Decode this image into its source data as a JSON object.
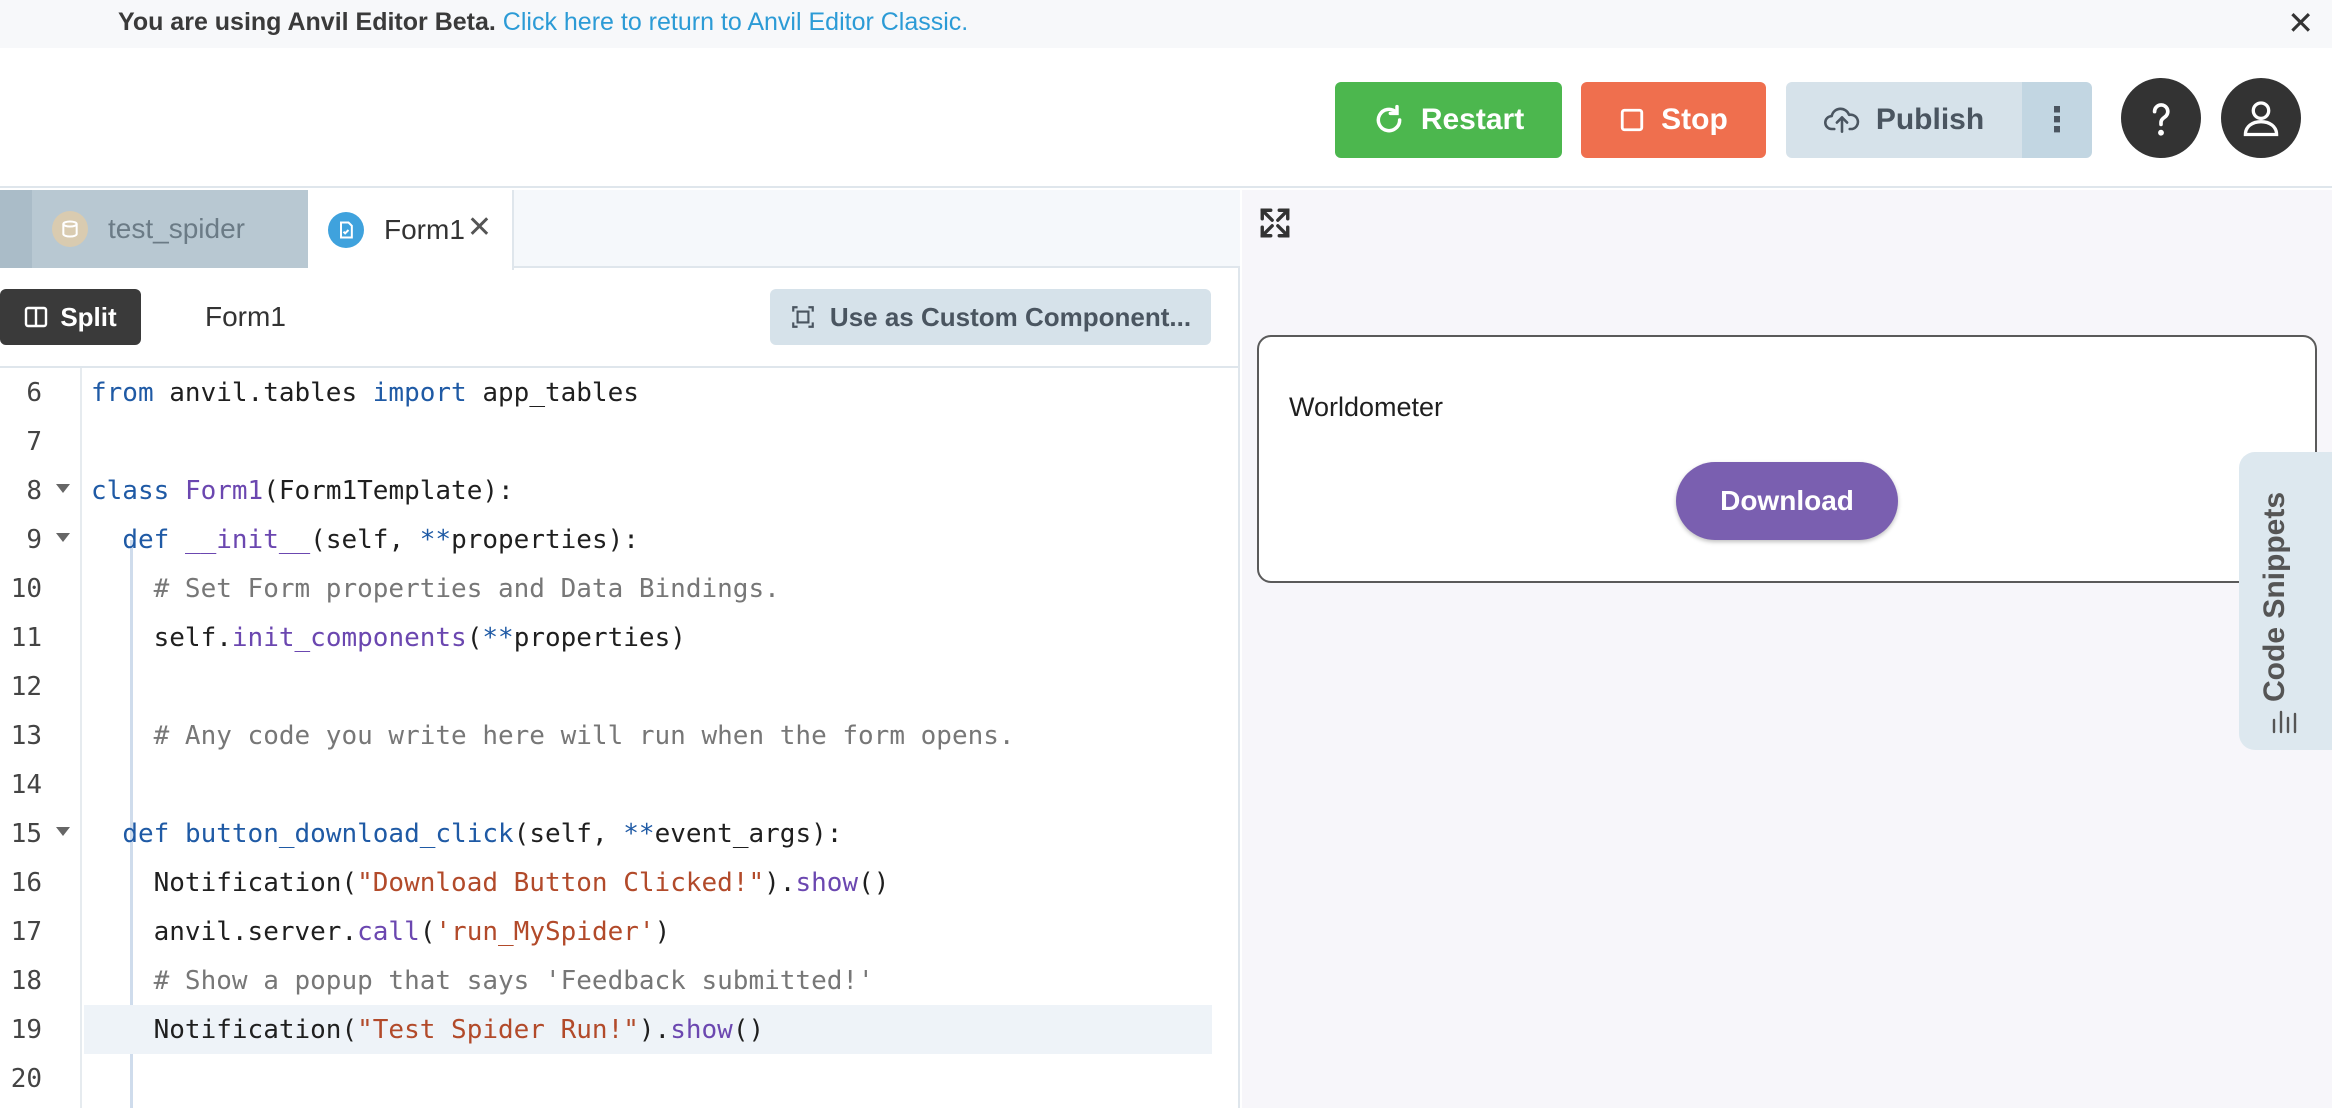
{
  "banner": {
    "bold_text": "You are using Anvil Editor Beta.",
    "link_text": "Click here to return to Anvil Editor Classic.",
    "close_glyph": "✕"
  },
  "toolbar": {
    "restart_label": "Restart",
    "stop_label": "Stop",
    "publish_label": "Publish",
    "more_glyph": "⋮",
    "colors": {
      "restart": "#4cb74e",
      "stop": "#ef6f4e",
      "publish": "#d6e2ea"
    }
  },
  "tabs": [
    {
      "label": "test_spider",
      "icon": "database-icon"
    },
    {
      "label": "Form1",
      "icon": "form-icon",
      "close": "✕"
    }
  ],
  "subbar": {
    "split_label": "Split",
    "form_title": "Form1",
    "custom_label": "Use as Custom Component..."
  },
  "code": {
    "lines": [
      {
        "n": "6"
      },
      {
        "n": "7"
      },
      {
        "n": "8"
      },
      {
        "n": "9"
      },
      {
        "n": "10"
      },
      {
        "n": "11"
      },
      {
        "n": "12"
      },
      {
        "n": "13"
      },
      {
        "n": "14"
      },
      {
        "n": "15"
      },
      {
        "n": "16"
      },
      {
        "n": "17"
      },
      {
        "n": "18"
      },
      {
        "n": "19"
      },
      {
        "n": "20"
      }
    ],
    "t": {
      "from": "from",
      "anvil_tables": " anvil.tables ",
      "import": "import",
      "app_tables": " app_tables",
      "class": "class",
      "form1": "Form1",
      "form1_tpl": "(Form1Template):",
      "def": "def",
      "init": "__init__",
      "init_args_a": "(self, ",
      "op": "**",
      "init_args_b": "properties):",
      "cm_set": "# Set Form properties and Data Bindings.",
      "self_dot": "self.",
      "init_components": "init_components",
      "init_comp_args_b": "properties)",
      "cm_any": "# Any code you write here will run when the form opens.",
      "btn_fn": "button_download_click",
      "btn_args_b": "event_args):",
      "notification": "Notification(",
      "str_dl": "\"Download Button Clicked!\"",
      "close_paren_dot": ").",
      "show": "show",
      "parens": "()",
      "anvil_server": "anvil.server.",
      "call": "call",
      "open_paren": "(",
      "str_spider": "'run_MySpider'",
      "close_paren": ")",
      "cm_popup": "# Show a popup that says 'Feedback submitted!'",
      "str_test": "\"Test Spider Run!\""
    }
  },
  "preview": {
    "label": "Worldometer",
    "download_label": "Download",
    "download_color": "#7a5fb0",
    "snippets_label": "Code Snippets"
  }
}
